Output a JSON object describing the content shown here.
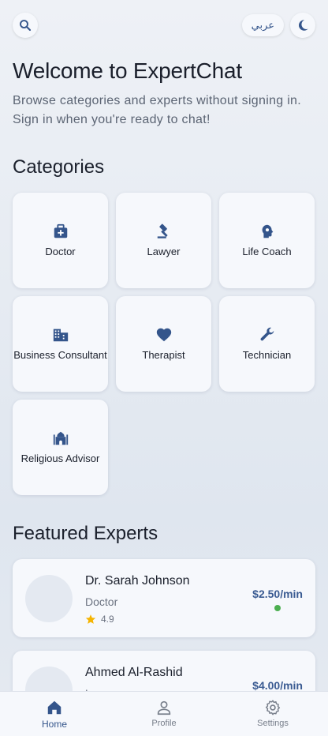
{
  "header": {
    "language_label": "عربي"
  },
  "welcome": {
    "title": "Welcome to ExpertChat",
    "subtitle": "Browse categories and experts without signing in. Sign in when you're ready to chat!"
  },
  "categories": {
    "title": "Categories",
    "items": [
      {
        "label": "Doctor",
        "icon": "medical-bag-icon"
      },
      {
        "label": "Lawyer",
        "icon": "gavel-icon"
      },
      {
        "label": "Life Coach",
        "icon": "head-psychology-icon"
      },
      {
        "label": "Business Consultant",
        "icon": "business-building-icon"
      },
      {
        "label": "Therapist",
        "icon": "heart-icon"
      },
      {
        "label": "Technician",
        "icon": "wrench-icon"
      },
      {
        "label": "Religious Advisor",
        "icon": "mosque-icon"
      }
    ]
  },
  "featured": {
    "title": "Featured Experts",
    "experts": [
      {
        "name": "Dr. Sarah Johnson",
        "role": "Doctor",
        "rating": "4.9",
        "price": "$2.50/min",
        "online": true
      },
      {
        "name": "Ahmed Al-Rashid",
        "role": "Lawyer",
        "price": "$4.00/min"
      }
    ]
  },
  "nav": {
    "home": "Home",
    "profile": "Profile",
    "settings": "Settings"
  },
  "colors": {
    "accent": "#3a5b92",
    "online": "#4caf50",
    "star": "#f5b400"
  }
}
